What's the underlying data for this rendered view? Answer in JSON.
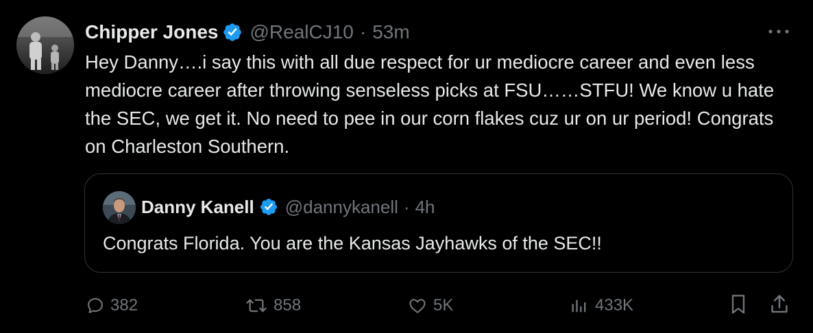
{
  "tweet": {
    "author_name": "Chipper Jones",
    "author_handle": "@RealCJ10",
    "separator": "·",
    "time": "53m",
    "text": "Hey Danny….i say this with all due respect for ur mediocre career and even less mediocre career after throwing senseless picks at FSU……STFU! We know u hate the SEC, we get it. No need to pee in our corn flakes cuz ur on ur period! Congrats on Charleston Southern.",
    "verified": true
  },
  "quote": {
    "author_name": "Danny Kanell",
    "author_handle": "@dannykanell",
    "separator": "·",
    "time": "4h",
    "text": "Congrats Florida. You are the Kansas Jayhawks of the SEC!!",
    "verified": true
  },
  "actions": {
    "reply_count": "382",
    "retweet_count": "858",
    "like_count": "5K",
    "view_count": "433K"
  },
  "icons": {
    "more": "more-options-icon",
    "verified": "verified-badge-icon",
    "reply": "reply-icon",
    "retweet": "retweet-icon",
    "like": "like-icon",
    "views": "views-icon",
    "bookmark": "bookmark-icon",
    "share": "share-icon"
  },
  "colors": {
    "background": "#000000",
    "text_primary": "#e7e9ea",
    "text_secondary": "#71767b",
    "verified_blue": "#1d9bf0",
    "border": "#2f3336"
  }
}
